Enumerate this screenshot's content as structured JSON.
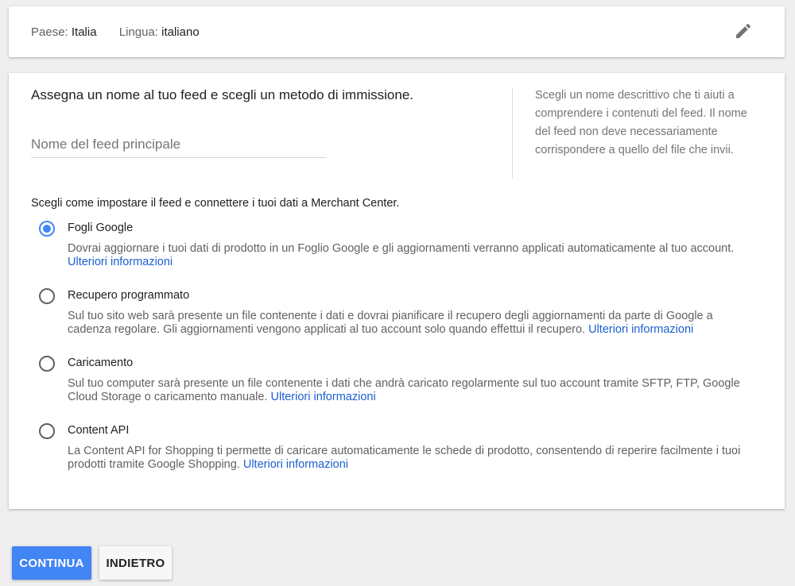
{
  "header": {
    "country_label": "Paese:",
    "country_value": "Italia",
    "language_label": "Lingua:",
    "language_value": "italiano",
    "edit_icon": "pencil-icon"
  },
  "feed_name": {
    "heading": "Assegna un nome al tuo feed e scegli un metodo di immissione.",
    "input_placeholder": "Nome del feed principale",
    "input_value": "",
    "help_text": "Scegli un nome descrittivo che ti aiuti a comprendere i contenuti del feed. Il nome del feed non deve necessariamente corrispondere a quello del file che invii."
  },
  "setup": {
    "label": "Scegli come impostare il feed e connettere i tuoi dati a Merchant Center.",
    "link_text": "Ulteriori informazioni",
    "selected_index": 0,
    "options": [
      {
        "title": "Fogli Google",
        "description": "Dovrai aggiornare i tuoi dati di prodotto in un Foglio Google e gli aggiornamenti verranno applicati automaticamente al tuo account."
      },
      {
        "title": "Recupero programmato",
        "description": "Sul tuo sito web sarà presente un file contenente i dati e dovrai pianificare il recupero degli aggiornamenti da parte di Google a cadenza regolare. Gli aggiornamenti vengono applicati al tuo account solo quando effettui il recupero."
      },
      {
        "title": "Caricamento",
        "description": "Sul tuo computer sarà presente un file contenente i dati che andrà caricato regolarmente sul tuo account tramite SFTP, FTP, Google Cloud Storage o caricamento manuale."
      },
      {
        "title": "Content API",
        "description": "La Content API for Shopping ti permette di caricare automaticamente le schede di prodotto, consentendo di reperire facilmente i tuoi prodotti tramite Google Shopping."
      }
    ]
  },
  "buttons": {
    "continue_label": "CONTINUA",
    "back_label": "INDIETRO"
  },
  "colors": {
    "accent": "#4285f4",
    "link": "#1a5fd0",
    "background": "#efefef"
  }
}
